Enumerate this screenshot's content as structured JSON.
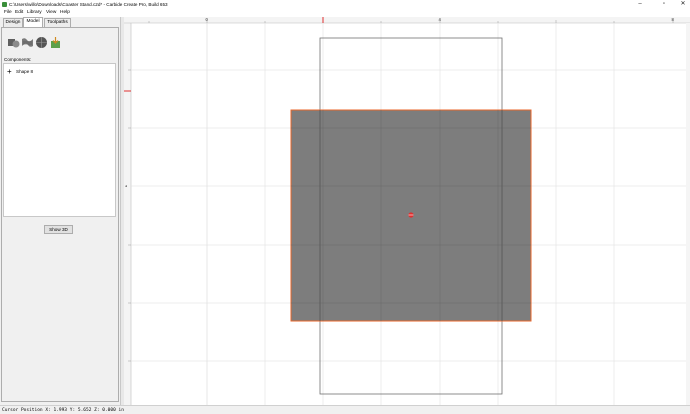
{
  "window": {
    "title": "C:\\Users\\willo\\Downloads\\Coaster Stand.c2d* - Carbide Create Pro, Build 653",
    "minimize_icon": "minimize-icon",
    "maximize_icon": "maximize-icon",
    "close_icon": "close-icon"
  },
  "menu": [
    "File",
    "Edit",
    "Library",
    "View",
    "Help"
  ],
  "tabs": [
    {
      "label": "Design",
      "active": false
    },
    {
      "label": "Model",
      "active": true
    },
    {
      "label": "Toolpaths",
      "active": false
    }
  ],
  "tools": [
    {
      "name": "add-shape-tool-icon",
      "color": "#6d6d6d"
    },
    {
      "name": "texture-tool-icon",
      "color": "#7a7a7a"
    },
    {
      "name": "sphere-tool-icon",
      "color": "#555555"
    },
    {
      "name": "import-model-tool-icon",
      "color": "#5da04a"
    }
  ],
  "components": {
    "label": "Components:",
    "items": [
      {
        "label": "Shape 8"
      }
    ]
  },
  "show3d_label": "Show 3D",
  "ruler": {
    "labels": [
      "0",
      "4",
      "8"
    ]
  },
  "colors": {
    "shape_fill": "#7d7d7d",
    "shape_outline": "#e8662a",
    "marker": "#e03030"
  },
  "status": {
    "text": "Cursor Position X: 1.993 Y: 5.652 Z: 0.000 in"
  }
}
